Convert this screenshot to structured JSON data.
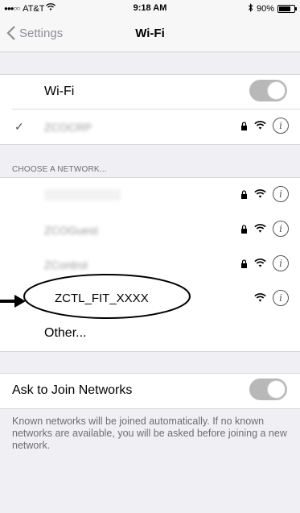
{
  "status": {
    "carrier": "AT&T",
    "signal": "●●●○○",
    "time": "9:18 AM",
    "battery_text": "90%",
    "battery_level": 0.9
  },
  "nav": {
    "back_label": "Settings",
    "title": "Wi-Fi"
  },
  "wifi": {
    "label": "Wi-Fi",
    "enabled": true,
    "connected_network": "ZCOCRP"
  },
  "choose_header": "CHOOSE A NETWORK...",
  "networks": [
    {
      "name": "",
      "locked": true,
      "blurred": true
    },
    {
      "name": "ZCOGuest",
      "locked": true,
      "blurred": true
    },
    {
      "name": "ZControl",
      "locked": true,
      "blurred": true
    },
    {
      "name": "ZCTL_FIT_XXXX",
      "locked": false,
      "blurred": false
    }
  ],
  "other_label": "Other...",
  "ask_join": {
    "label": "Ask to Join Networks",
    "enabled": true,
    "footer": "Known networks will be joined automatically. If no known networks are available, you will be asked before joining a new network."
  },
  "colors": {
    "toggle_on": "#b8b8b8",
    "background": "#efeff4"
  }
}
